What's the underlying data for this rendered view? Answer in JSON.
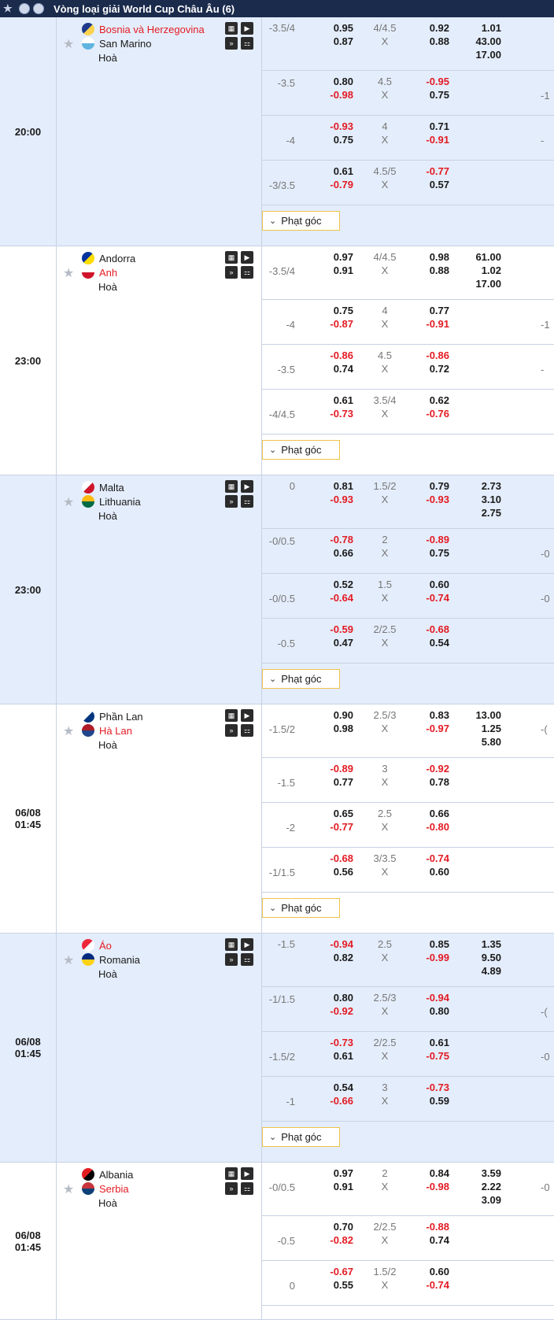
{
  "header": {
    "title": "Vòng loại giải World Cup Châu Âu (6)"
  },
  "corner_label": "Phạt góc",
  "colors": {
    "header_bg": "#1a2b4c",
    "row_blue": "#e4edfb",
    "negative": "#e31b23",
    "corner_border": "#f0c24d"
  },
  "matches": [
    {
      "time": "20:00",
      "date": "",
      "home": {
        "name": "Bosnia và Herzegovina",
        "flag": [
          "#1e3a8a",
          "#fcd34d"
        ]
      },
      "away": {
        "name": "San Marino",
        "flag": [
          "#ffffff",
          "#5fb4e0"
        ]
      },
      "draw": "Hoà",
      "rows": [
        {
          "hc": "-3.5/4",
          "h1": "0.95",
          "h2": "0.87",
          "tot": "4/4.5",
          "o1": "0.92",
          "o2": "0.88",
          "x": [
            "1.01",
            "43.00",
            "17.00"
          ],
          "edge": ""
        },
        {
          "hc": "-3.5",
          "h1": "0.80",
          "h2": "-0.98",
          "tot": "4.5",
          "o1": "-0.95",
          "o2": "0.75",
          "x": [],
          "edge": "-1"
        },
        {
          "hc": "-4",
          "h1": "-0.93",
          "h2": "0.75",
          "tot": "4",
          "o1": "0.71",
          "o2": "-0.91",
          "x": [],
          "edge": "-"
        },
        {
          "hc": "-3/3.5",
          "h1": "0.61",
          "h2": "-0.79",
          "tot": "4.5/5",
          "o1": "-0.77",
          "o2": "0.57",
          "x": [],
          "edge": ""
        }
      ]
    },
    {
      "time": "23:00",
      "date": "",
      "home": {
        "name": "Andorra",
        "flag": [
          "#0033a0",
          "#fedd00"
        ]
      },
      "away": {
        "name": "Anh",
        "flag": [
          "#ffffff",
          "#cf142b"
        ]
      },
      "draw": "Hoà",
      "rows": [
        {
          "hc": "-3.5/4",
          "h1": "0.97",
          "h2": "0.91",
          "tot": "4/4.5",
          "o1": "0.98",
          "o2": "0.88",
          "x": [
            "61.00",
            "1.02",
            "17.00"
          ],
          "edge": ""
        },
        {
          "hc": "-4",
          "h1": "0.75",
          "h2": "-0.87",
          "tot": "4",
          "o1": "0.77",
          "o2": "-0.91",
          "x": [],
          "edge": "-1"
        },
        {
          "hc": "-3.5",
          "h1": "-0.86",
          "h2": "0.74",
          "tot": "4.5",
          "o1": "-0.86",
          "o2": "0.72",
          "x": [],
          "edge": "-"
        },
        {
          "hc": "-4/4.5",
          "h1": "0.61",
          "h2": "-0.73",
          "tot": "3.5/4",
          "o1": "0.62",
          "o2": "-0.76",
          "x": [],
          "edge": ""
        }
      ]
    },
    {
      "time": "23:00",
      "date": "",
      "home": {
        "name": "Malta",
        "flag": [
          "#ffffff",
          "#cf142b"
        ]
      },
      "away": {
        "name": "Lithuania",
        "flag": [
          "#fdb913",
          "#006a44"
        ]
      },
      "draw": "Hoà",
      "rows": [
        {
          "hc": "0",
          "h1": "0.81",
          "h2": "-0.93",
          "tot": "1.5/2",
          "o1": "0.79",
          "o2": "-0.93",
          "x": [
            "2.73",
            "3.10",
            "2.75"
          ],
          "edge": ""
        },
        {
          "hc": "-0/0.5",
          "h1": "-0.78",
          "h2": "0.66",
          "tot": "2",
          "o1": "-0.89",
          "o2": "0.75",
          "x": [],
          "edge": "-0"
        },
        {
          "hc": "-0/0.5",
          "h1": "0.52",
          "h2": "-0.64",
          "tot": "1.5",
          "o1": "0.60",
          "o2": "-0.74",
          "x": [],
          "edge": "-0"
        },
        {
          "hc": "-0.5",
          "h1": "-0.59",
          "h2": "0.47",
          "tot": "2/2.5",
          "o1": "-0.68",
          "o2": "0.54",
          "x": [],
          "edge": ""
        }
      ]
    },
    {
      "time": "06/08",
      "date": "01:45",
      "home": {
        "name": "Phần Lan",
        "flag": [
          "#ffffff",
          "#003580"
        ]
      },
      "away": {
        "name": "Hà Lan",
        "flag": [
          "#ae1c28",
          "#21468b"
        ]
      },
      "draw": "Hoà",
      "rows": [
        {
          "hc": "-1.5/2",
          "h1": "0.90",
          "h2": "0.98",
          "tot": "2.5/3",
          "o1": "0.83",
          "o2": "-0.97",
          "x": [
            "13.00",
            "1.25",
            "5.80"
          ],
          "edge": "-("
        },
        {
          "hc": "-1.5",
          "h1": "-0.89",
          "h2": "0.77",
          "tot": "3",
          "o1": "-0.92",
          "o2": "0.78",
          "x": [],
          "edge": ""
        },
        {
          "hc": "-2",
          "h1": "0.65",
          "h2": "-0.77",
          "tot": "2.5",
          "o1": "0.66",
          "o2": "-0.80",
          "x": [],
          "edge": ""
        },
        {
          "hc": "-1/1.5",
          "h1": "-0.68",
          "h2": "0.56",
          "tot": "3/3.5",
          "o1": "-0.74",
          "o2": "0.60",
          "x": [],
          "edge": ""
        }
      ]
    },
    {
      "time": "06/08",
      "date": "01:45",
      "home": {
        "name": "Áo",
        "flag": [
          "#ed2939",
          "#ffffff"
        ]
      },
      "away": {
        "name": "Romania",
        "flag": [
          "#002b7f",
          "#fcd116"
        ]
      },
      "draw": "Hoà",
      "rows": [
        {
          "hc": "-1.5",
          "h1": "-0.94",
          "h2": "0.82",
          "tot": "2.5",
          "o1": "0.85",
          "o2": "-0.99",
          "x": [
            "1.35",
            "9.50",
            "4.89"
          ],
          "edge": ""
        },
        {
          "hc": "-1/1.5",
          "h1": "0.80",
          "h2": "-0.92",
          "tot": "2.5/3",
          "o1": "-0.94",
          "o2": "0.80",
          "x": [],
          "edge": "-("
        },
        {
          "hc": "-1.5/2",
          "h1": "-0.73",
          "h2": "0.61",
          "tot": "2/2.5",
          "o1": "0.61",
          "o2": "-0.75",
          "x": [],
          "edge": "-0"
        },
        {
          "hc": "-1",
          "h1": "0.54",
          "h2": "-0.66",
          "tot": "3",
          "o1": "-0.73",
          "o2": "0.59",
          "x": [],
          "edge": ""
        }
      ]
    },
    {
      "time": "06/08",
      "date": "01:45",
      "home": {
        "name": "Albania",
        "flag": [
          "#e41e20",
          "#000000"
        ]
      },
      "away": {
        "name": "Serbia",
        "flag": [
          "#c6363c",
          "#0c4076"
        ]
      },
      "draw": "Hoà",
      "rows": [
        {
          "hc": "-0/0.5",
          "h1": "0.97",
          "h2": "0.91",
          "tot": "2",
          "o1": "0.84",
          "o2": "-0.98",
          "x": [
            "3.59",
            "2.22",
            "3.09"
          ],
          "edge": "-0"
        },
        {
          "hc": "-0.5",
          "h1": "0.70",
          "h2": "-0.82",
          "tot": "2/2.5",
          "o1": "-0.88",
          "o2": "0.74",
          "x": [],
          "edge": ""
        },
        {
          "hc": "0",
          "h1": "-0.67",
          "h2": "0.55",
          "tot": "1.5/2",
          "o1": "0.60",
          "o2": "-0.74",
          "x": [],
          "edge": ""
        }
      ]
    }
  ]
}
